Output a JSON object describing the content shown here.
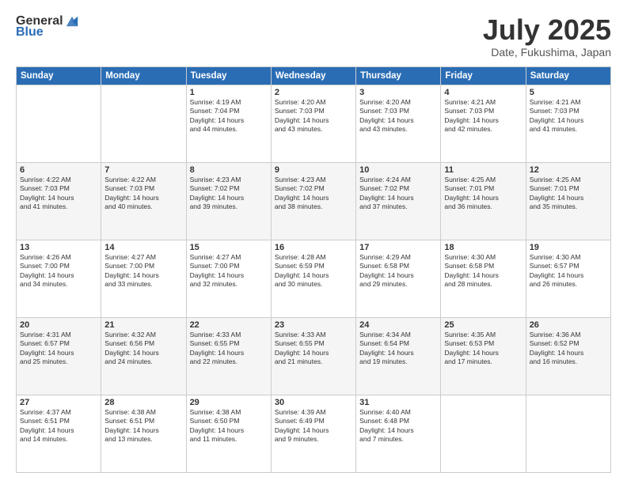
{
  "header": {
    "logo_general": "General",
    "logo_blue": "Blue",
    "month": "July 2025",
    "location": "Date, Fukushima, Japan"
  },
  "weekdays": [
    "Sunday",
    "Monday",
    "Tuesday",
    "Wednesday",
    "Thursday",
    "Friday",
    "Saturday"
  ],
  "weeks": [
    [
      {
        "day": "",
        "info": ""
      },
      {
        "day": "",
        "info": ""
      },
      {
        "day": "1",
        "info": "Sunrise: 4:19 AM\nSunset: 7:04 PM\nDaylight: 14 hours\nand 44 minutes."
      },
      {
        "day": "2",
        "info": "Sunrise: 4:20 AM\nSunset: 7:03 PM\nDaylight: 14 hours\nand 43 minutes."
      },
      {
        "day": "3",
        "info": "Sunrise: 4:20 AM\nSunset: 7:03 PM\nDaylight: 14 hours\nand 43 minutes."
      },
      {
        "day": "4",
        "info": "Sunrise: 4:21 AM\nSunset: 7:03 PM\nDaylight: 14 hours\nand 42 minutes."
      },
      {
        "day": "5",
        "info": "Sunrise: 4:21 AM\nSunset: 7:03 PM\nDaylight: 14 hours\nand 41 minutes."
      }
    ],
    [
      {
        "day": "6",
        "info": "Sunrise: 4:22 AM\nSunset: 7:03 PM\nDaylight: 14 hours\nand 41 minutes."
      },
      {
        "day": "7",
        "info": "Sunrise: 4:22 AM\nSunset: 7:03 PM\nDaylight: 14 hours\nand 40 minutes."
      },
      {
        "day": "8",
        "info": "Sunrise: 4:23 AM\nSunset: 7:02 PM\nDaylight: 14 hours\nand 39 minutes."
      },
      {
        "day": "9",
        "info": "Sunrise: 4:23 AM\nSunset: 7:02 PM\nDaylight: 14 hours\nand 38 minutes."
      },
      {
        "day": "10",
        "info": "Sunrise: 4:24 AM\nSunset: 7:02 PM\nDaylight: 14 hours\nand 37 minutes."
      },
      {
        "day": "11",
        "info": "Sunrise: 4:25 AM\nSunset: 7:01 PM\nDaylight: 14 hours\nand 36 minutes."
      },
      {
        "day": "12",
        "info": "Sunrise: 4:25 AM\nSunset: 7:01 PM\nDaylight: 14 hours\nand 35 minutes."
      }
    ],
    [
      {
        "day": "13",
        "info": "Sunrise: 4:26 AM\nSunset: 7:00 PM\nDaylight: 14 hours\nand 34 minutes."
      },
      {
        "day": "14",
        "info": "Sunrise: 4:27 AM\nSunset: 7:00 PM\nDaylight: 14 hours\nand 33 minutes."
      },
      {
        "day": "15",
        "info": "Sunrise: 4:27 AM\nSunset: 7:00 PM\nDaylight: 14 hours\nand 32 minutes."
      },
      {
        "day": "16",
        "info": "Sunrise: 4:28 AM\nSunset: 6:59 PM\nDaylight: 14 hours\nand 30 minutes."
      },
      {
        "day": "17",
        "info": "Sunrise: 4:29 AM\nSunset: 6:58 PM\nDaylight: 14 hours\nand 29 minutes."
      },
      {
        "day": "18",
        "info": "Sunrise: 4:30 AM\nSunset: 6:58 PM\nDaylight: 14 hours\nand 28 minutes."
      },
      {
        "day": "19",
        "info": "Sunrise: 4:30 AM\nSunset: 6:57 PM\nDaylight: 14 hours\nand 26 minutes."
      }
    ],
    [
      {
        "day": "20",
        "info": "Sunrise: 4:31 AM\nSunset: 6:57 PM\nDaylight: 14 hours\nand 25 minutes."
      },
      {
        "day": "21",
        "info": "Sunrise: 4:32 AM\nSunset: 6:56 PM\nDaylight: 14 hours\nand 24 minutes."
      },
      {
        "day": "22",
        "info": "Sunrise: 4:33 AM\nSunset: 6:55 PM\nDaylight: 14 hours\nand 22 minutes."
      },
      {
        "day": "23",
        "info": "Sunrise: 4:33 AM\nSunset: 6:55 PM\nDaylight: 14 hours\nand 21 minutes."
      },
      {
        "day": "24",
        "info": "Sunrise: 4:34 AM\nSunset: 6:54 PM\nDaylight: 14 hours\nand 19 minutes."
      },
      {
        "day": "25",
        "info": "Sunrise: 4:35 AM\nSunset: 6:53 PM\nDaylight: 14 hours\nand 17 minutes."
      },
      {
        "day": "26",
        "info": "Sunrise: 4:36 AM\nSunset: 6:52 PM\nDaylight: 14 hours\nand 16 minutes."
      }
    ],
    [
      {
        "day": "27",
        "info": "Sunrise: 4:37 AM\nSunset: 6:51 PM\nDaylight: 14 hours\nand 14 minutes."
      },
      {
        "day": "28",
        "info": "Sunrise: 4:38 AM\nSunset: 6:51 PM\nDaylight: 14 hours\nand 13 minutes."
      },
      {
        "day": "29",
        "info": "Sunrise: 4:38 AM\nSunset: 6:50 PM\nDaylight: 14 hours\nand 11 minutes."
      },
      {
        "day": "30",
        "info": "Sunrise: 4:39 AM\nSunset: 6:49 PM\nDaylight: 14 hours\nand 9 minutes."
      },
      {
        "day": "31",
        "info": "Sunrise: 4:40 AM\nSunset: 6:48 PM\nDaylight: 14 hours\nand 7 minutes."
      },
      {
        "day": "",
        "info": ""
      },
      {
        "day": "",
        "info": ""
      }
    ]
  ]
}
